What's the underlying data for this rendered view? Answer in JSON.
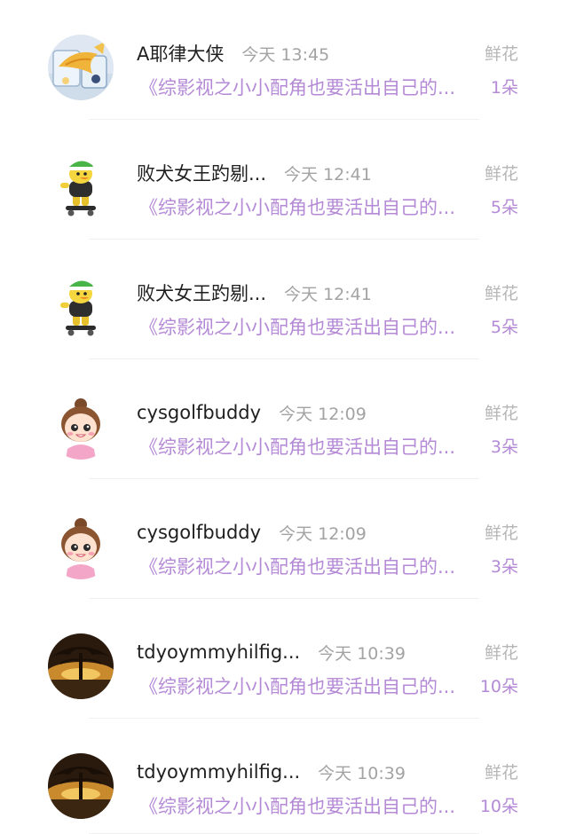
{
  "gift_records": [
    {
      "name": "A耶律大侠",
      "time": "今天 13:45",
      "title": "《综影视之小小配角也要活出自己的...",
      "gift_type": "鲜花",
      "count": "1朵",
      "avatar": "fish-photo-avatar"
    },
    {
      "name": "败犬女王趵剔...",
      "time": "今天 12:41",
      "title": "《综影视之小小配角也要活出自己的...",
      "gift_type": "鲜花",
      "count": "5朵",
      "avatar": "skateboard-duck-avatar"
    },
    {
      "name": "败犬女王趵剔...",
      "time": "今天 12:41",
      "title": "《综影视之小小配角也要活出自己的...",
      "gift_type": "鲜花",
      "count": "5朵",
      "avatar": "skateboard-duck-avatar"
    },
    {
      "name": "cysgolfbuddy",
      "time": "今天 12:09",
      "title": "《综影视之小小配角也要活出自己的...",
      "gift_type": "鲜花",
      "count": "3朵",
      "avatar": "cartoon-girl-avatar"
    },
    {
      "name": "cysgolfbuddy",
      "time": "今天 12:09",
      "title": "《综影视之小小配角也要活出自己的...",
      "gift_type": "鲜花",
      "count": "3朵",
      "avatar": "cartoon-girl-avatar"
    },
    {
      "name": "tdyoymmyhilfig...",
      "time": "今天 10:39",
      "title": "《综影视之小小配角也要活出自己的...",
      "gift_type": "鲜花",
      "count": "10朵",
      "avatar": "sunset-tree-avatar"
    },
    {
      "name": "tdyoymmyhilfig...",
      "time": "今天 10:39",
      "title": "《综影视之小小配角也要活出自己的...",
      "gift_type": "鲜花",
      "count": "10朵",
      "avatar": "sunset-tree-avatar"
    }
  ],
  "colors": {
    "accent_purple": "#b48ad6",
    "name_text": "#1f1f1f",
    "secondary_gray": "#a3a3a3"
  }
}
